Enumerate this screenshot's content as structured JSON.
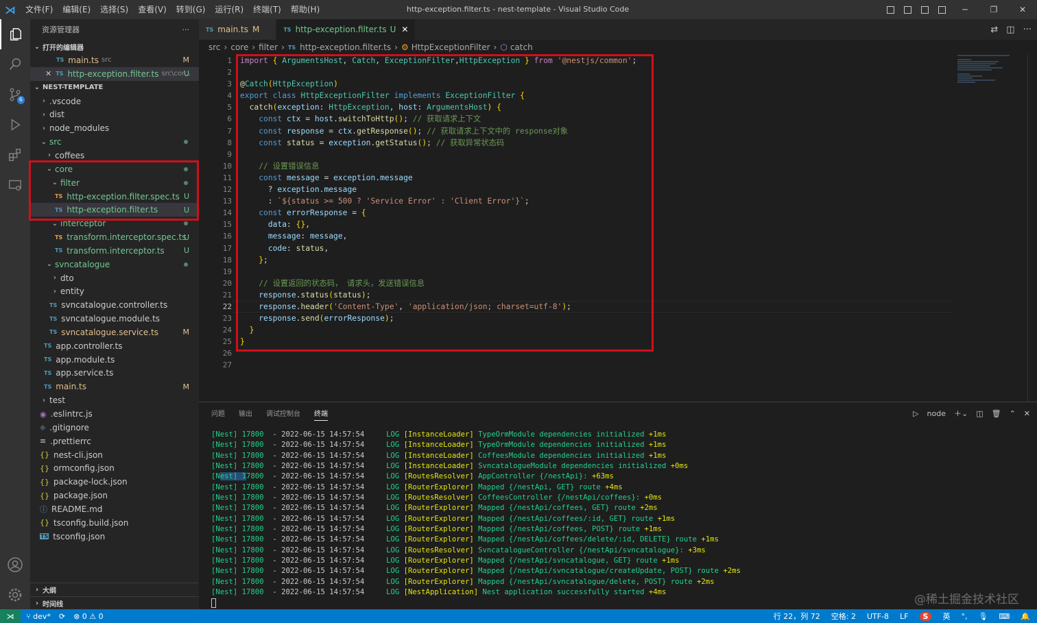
{
  "menu": [
    "文件(F)",
    "编辑(E)",
    "选择(S)",
    "查看(V)",
    "转到(G)",
    "运行(R)",
    "终端(T)",
    "帮助(H)"
  ],
  "window_title": "http-exception.filter.ts - nest-template - Visual Studio Code",
  "window_controls": {
    "minimize": "─",
    "maximize": "❐",
    "close": "✕"
  },
  "activity": {
    "scm_badge": "6"
  },
  "sidebar": {
    "title": "资源管理器",
    "more": "···",
    "open_editors_label": "打开的编辑器",
    "open_editors": [
      {
        "name": "main.ts",
        "hint": "src",
        "status": "M"
      },
      {
        "name": "http-exception.filter.ts",
        "hint": "src\\cor...",
        "status": "U"
      }
    ],
    "project_label": "NEST-TEMPLATE",
    "tree": [
      {
        "name": ".vscode",
        "status": ""
      },
      {
        "name": "dist",
        "status": ""
      },
      {
        "name": "node_modules",
        "status": ""
      },
      {
        "name": "src",
        "status": ""
      },
      {
        "name": "coffees",
        "status": ""
      },
      {
        "name": "core",
        "status": ""
      },
      {
        "name": "filter",
        "status": ""
      },
      {
        "name": "http-exception.filter.spec.ts",
        "status": "U"
      },
      {
        "name": "http-exception.filter.ts",
        "status": "U"
      },
      {
        "name": "interceptor",
        "status": ""
      },
      {
        "name": "transform.interceptor.spec.ts",
        "status": "U"
      },
      {
        "name": "transform.interceptor.ts",
        "status": "U"
      },
      {
        "name": "svncatalogue",
        "status": ""
      },
      {
        "name": "dto",
        "status": ""
      },
      {
        "name": "entity",
        "status": ""
      },
      {
        "name": "svncatalogue.controller.ts",
        "status": ""
      },
      {
        "name": "svncatalogue.module.ts",
        "status": ""
      },
      {
        "name": "svncatalogue.service.ts",
        "status": "M"
      },
      {
        "name": "app.controller.ts",
        "status": ""
      },
      {
        "name": "app.module.ts",
        "status": ""
      },
      {
        "name": "app.service.ts",
        "status": ""
      },
      {
        "name": "main.ts",
        "status": "M"
      },
      {
        "name": "test",
        "status": ""
      },
      {
        "name": ".eslintrc.js",
        "status": ""
      },
      {
        "name": ".gitignore",
        "status": ""
      },
      {
        "name": ".prettierrc",
        "status": ""
      },
      {
        "name": "nest-cli.json",
        "status": ""
      },
      {
        "name": "ormconfig.json",
        "status": ""
      },
      {
        "name": "package-lock.json",
        "status": ""
      },
      {
        "name": "package.json",
        "status": ""
      },
      {
        "name": "README.md",
        "status": ""
      },
      {
        "name": "tsconfig.build.json",
        "status": ""
      },
      {
        "name": "tsconfig.json",
        "status": ""
      }
    ],
    "outline_label": "大纲",
    "timeline_label": "时间线"
  },
  "icons": {
    "ts": "TS",
    "json": "{}"
  },
  "tabs": [
    {
      "name": "main.ts",
      "status": "M"
    },
    {
      "name": "http-exception.filter.ts",
      "status": "U",
      "close": "✕"
    }
  ],
  "breadcrumb": [
    "src",
    "core",
    "filter",
    "http-exception.filter.ts",
    "HttpExceptionFilter",
    "catch"
  ],
  "editor": {
    "line_numbers": [
      "1",
      "2",
      "3",
      "4",
      "5",
      "6",
      "7",
      "8",
      "9",
      "10",
      "11",
      "12",
      "13",
      "14",
      "15",
      "16",
      "17",
      "18",
      "19",
      "20",
      "21",
      "22",
      "23",
      "24",
      "25",
      "26",
      "27"
    ],
    "lines": [
      "import { ArgumentsHost, Catch, ExceptionFilter,HttpException } from '@nestjs/common';",
      "",
      "@Catch(HttpException)",
      "export class HttpExceptionFilter implements ExceptionFilter {",
      "  catch(exception: HttpException, host: ArgumentsHost) {",
      "    const ctx = host.switchToHttp(); // 获取请求上下文",
      "    const response = ctx.getResponse(); // 获取请求上下文中的 response对象",
      "    const status = exception.getStatus(); // 获取异常状态码",
      "",
      "    // 设置错误信息",
      "    const message = exception.message",
      "      ? exception.message",
      "      : `${status >= 500 ? 'Service Error' : 'Client Error'}`;",
      "    const errorResponse = {",
      "      data: {},",
      "      message: message,",
      "      code: status,",
      "    };",
      "",
      "    // 设置返回的状态码， 请求头，发送错误信息",
      "    response.status(status);",
      "    response.header('Content-Type', 'application/json; charset=utf-8');",
      "    response.send(errorResponse);",
      "  }",
      "}",
      "",
      ""
    ]
  },
  "panel": {
    "tabs": [
      "问题",
      "输出",
      "调试控制台",
      "终端"
    ],
    "terminal_name": "node",
    "log": [
      [
        "[Nest] 17800",
        "- 2022-06-15 14:57:54",
        "LOG",
        "[InstanceLoader]",
        "TypeOrmModule dependencies initialized",
        "+1ms"
      ],
      [
        "[Nest] 17800",
        "- 2022-06-15 14:57:54",
        "LOG",
        "[InstanceLoader]",
        "TypeOrmModule dependencies initialized",
        "+1ms"
      ],
      [
        "[Nest] 17800",
        "- 2022-06-15 14:57:54",
        "LOG",
        "[InstanceLoader]",
        "CoffeesModule dependencies initialized",
        "+1ms"
      ],
      [
        "[Nest] 17800",
        "- 2022-06-15 14:57:54",
        "LOG",
        "[InstanceLoader]",
        "SvncatalogueModule dependencies initialized",
        "+0ms"
      ],
      [
        "[Nest] 17800",
        "- 2022-06-15 14:57:54",
        "LOG",
        "[RoutesResolver]",
        "AppController {/nestApi}:",
        "+63ms"
      ],
      [
        "[Nest] 17800",
        "- 2022-06-15 14:57:54",
        "LOG",
        "[RouterExplorer]",
        "Mapped {/nestApi, GET} route",
        "+4ms"
      ],
      [
        "[Nest] 17800",
        "- 2022-06-15 14:57:54",
        "LOG",
        "[RoutesResolver]",
        "CoffeesController {/nestApi/coffees}:",
        "+0ms"
      ],
      [
        "[Nest] 17800",
        "- 2022-06-15 14:57:54",
        "LOG",
        "[RouterExplorer]",
        "Mapped {/nestApi/coffees, GET} route",
        "+2ms"
      ],
      [
        "[Nest] 17800",
        "- 2022-06-15 14:57:54",
        "LOG",
        "[RouterExplorer]",
        "Mapped {/nestApi/coffees/:id, GET} route",
        "+1ms"
      ],
      [
        "[Nest] 17800",
        "- 2022-06-15 14:57:54",
        "LOG",
        "[RouterExplorer]",
        "Mapped {/nestApi/coffees, POST} route",
        "+1ms"
      ],
      [
        "[Nest] 17800",
        "- 2022-06-15 14:57:54",
        "LOG",
        "[RouterExplorer]",
        "Mapped {/nestApi/coffees/delete/:id, DELETE} route",
        "+1ms"
      ],
      [
        "[Nest] 17800",
        "- 2022-06-15 14:57:54",
        "LOG",
        "[RoutesResolver]",
        "SvncatalogueController {/nestApi/svncatalogue}:",
        "+3ms"
      ],
      [
        "[Nest] 17800",
        "- 2022-06-15 14:57:54",
        "LOG",
        "[RouterExplorer]",
        "Mapped {/nestApi/svncatalogue, GET} route",
        "+1ms"
      ],
      [
        "[Nest] 17800",
        "- 2022-06-15 14:57:54",
        "LOG",
        "[RouterExplorer]",
        "Mapped {/nestApi/svncatalogue/createUpdate, POST} route",
        "+2ms"
      ],
      [
        "[Nest] 17800",
        "- 2022-06-15 14:57:54",
        "LOG",
        "[RouterExplorer]",
        "Mapped {/nestApi/svncatalogue/delete, POST} route",
        "+2ms"
      ],
      [
        "[Nest] 17800",
        "- 2022-06-15 14:57:54",
        "LOG",
        "[NestApplication]",
        "Nest application successfully started",
        "+4ms"
      ]
    ]
  },
  "watermark": "@稀土掘金技术社区",
  "status": {
    "branch": "dev*",
    "errors": "⊗ 0 ⚠ 0",
    "position": "行 22，列 72",
    "spaces": "空格: 2",
    "encoding": "UTF-8",
    "eol": "LF",
    "ime_logo": "S",
    "ime": "英"
  },
  "colors": {
    "accent": "#007acc",
    "highlight_box": "#d10f1b",
    "modified": "#e2c08d",
    "untracked": "#73c991"
  }
}
